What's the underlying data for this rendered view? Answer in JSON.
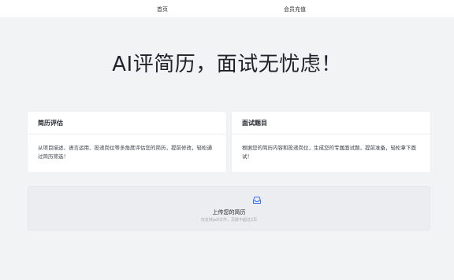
{
  "nav": {
    "home": "首页",
    "vip": "会员充值"
  },
  "headline": "AI评简历，面试无忧虑！",
  "cards": {
    "resume_eval": {
      "title": "简历评估",
      "body": "从项目描述、语言运用、投递岗位等多角度评估您的简历，提前修改，轻松通过简历筛选！"
    },
    "interview_questions": {
      "title": "面试题目",
      "body": "根据您的简历内容和投递岗位，生成您的专属面试题，提前准备，轻松拿下面试！"
    }
  },
  "upload": {
    "icon": "inbox-icon",
    "title": "上传您的简历",
    "hint": "仅支持pdf文件，页数不超过2页"
  },
  "colors": {
    "accent": "#3370ff",
    "background": "#f2f3f5",
    "card": "#ffffff"
  }
}
